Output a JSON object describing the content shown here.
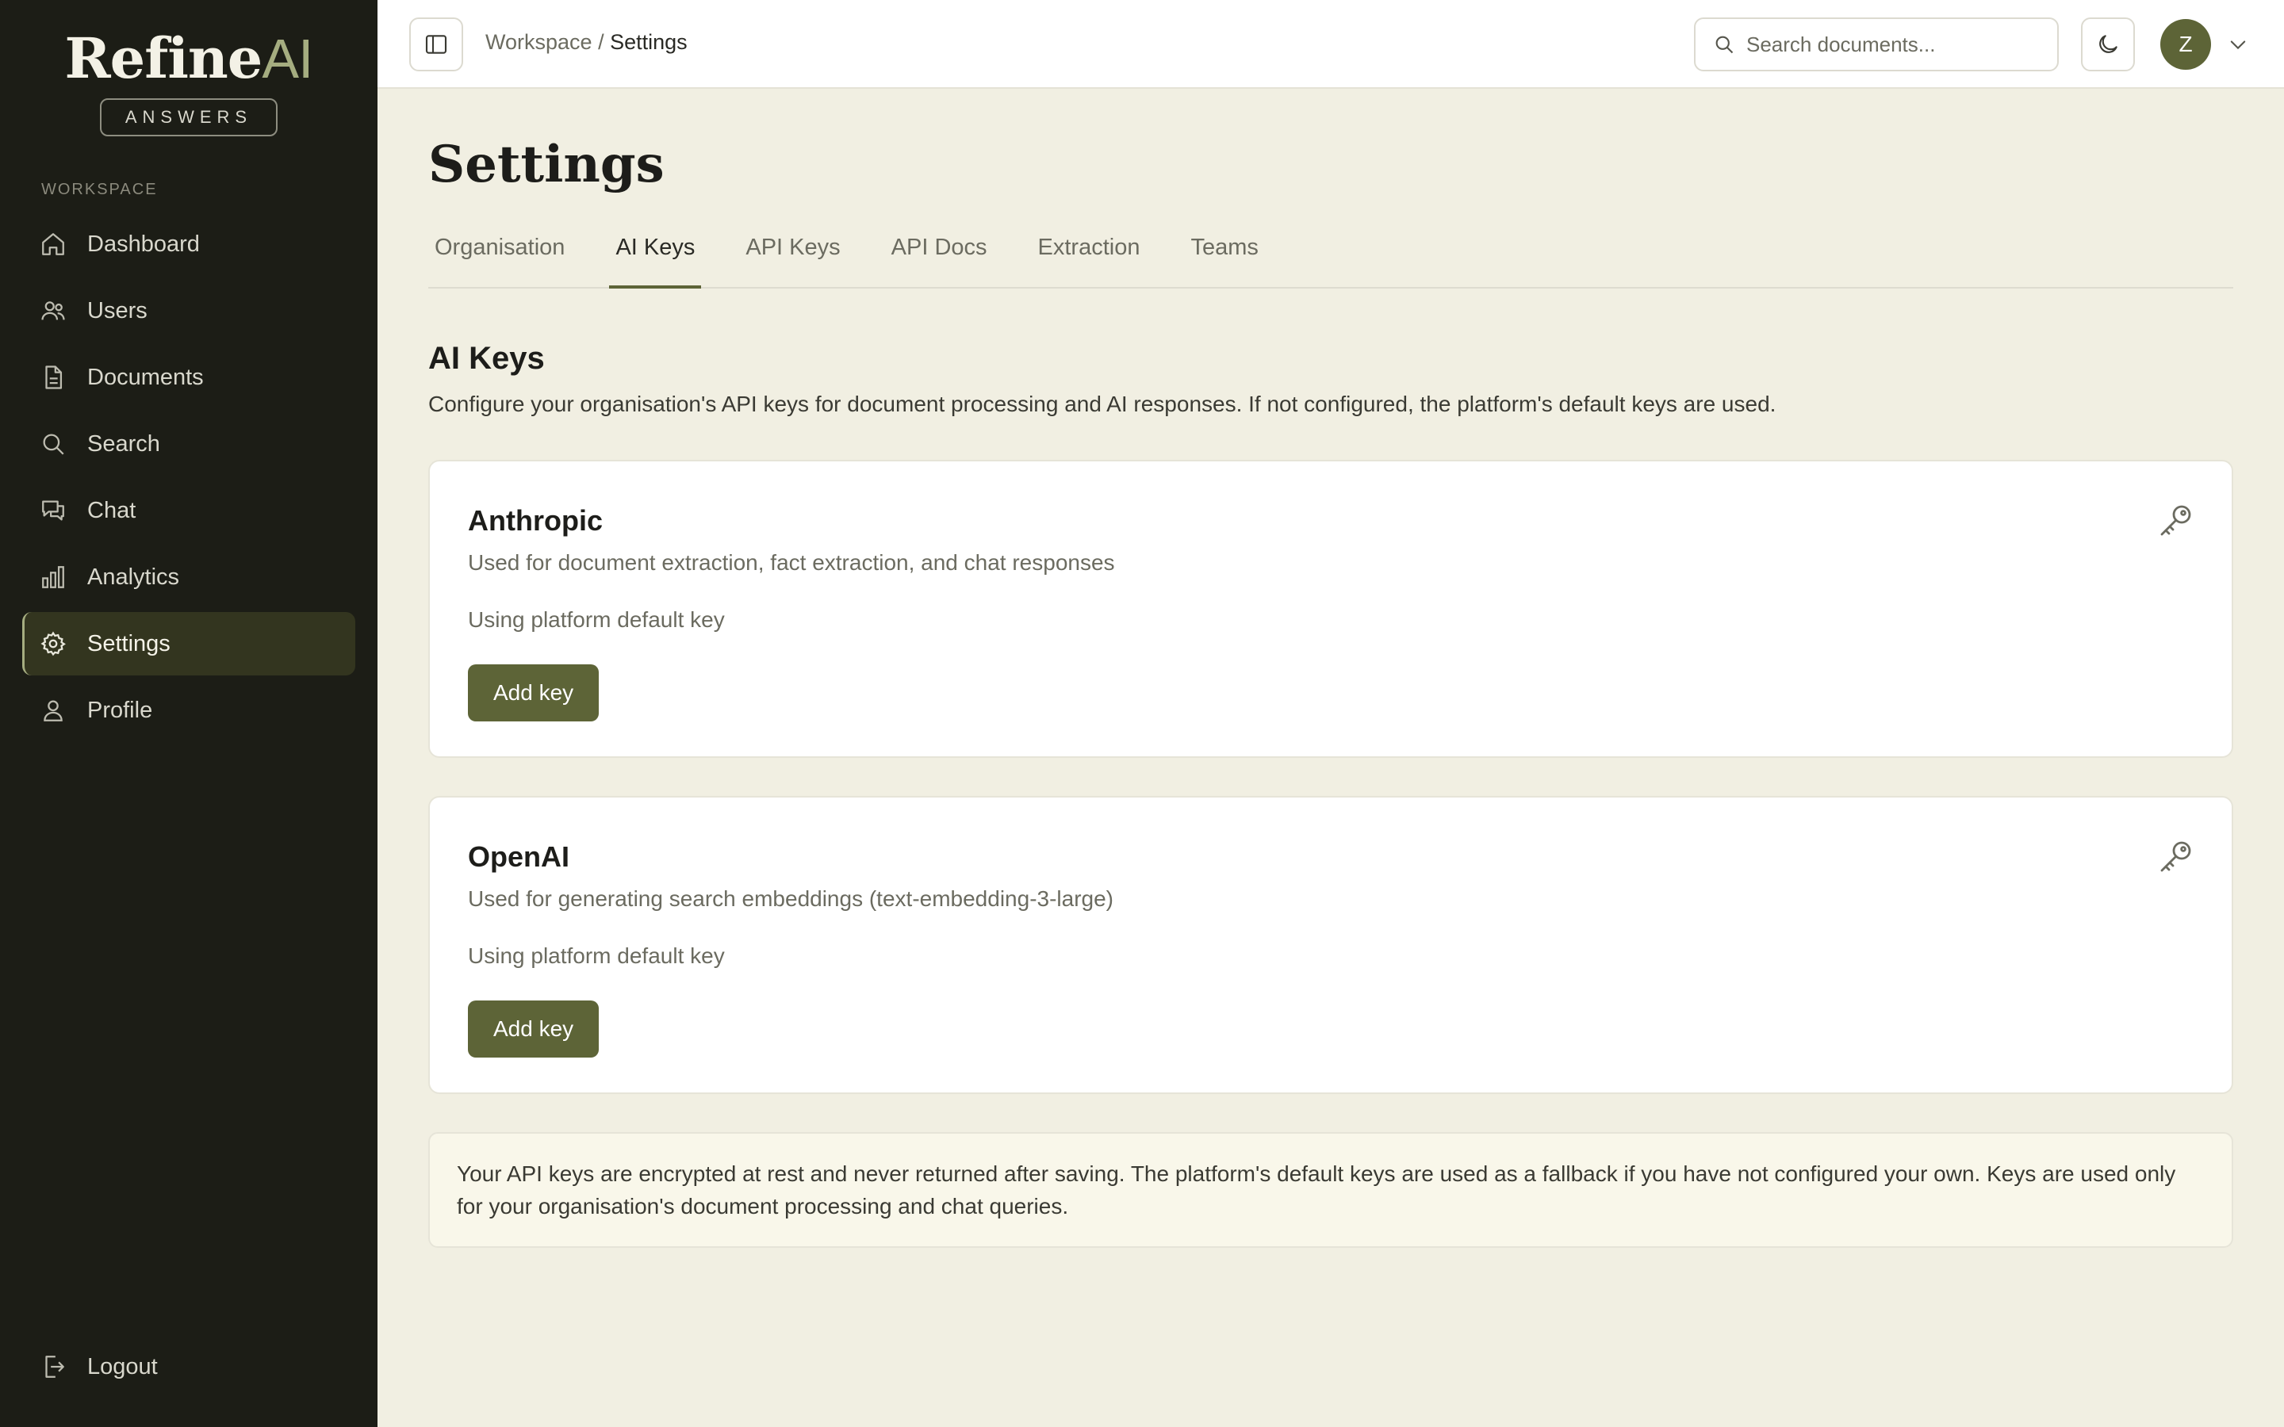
{
  "brand": {
    "name_main": "Refine",
    "name_accent": "AI",
    "subtitle": "ANSWERS"
  },
  "sidebar": {
    "section_label": "WORKSPACE",
    "items": [
      {
        "label": "Dashboard",
        "icon": "home-icon"
      },
      {
        "label": "Users",
        "icon": "users-icon"
      },
      {
        "label": "Documents",
        "icon": "document-icon"
      },
      {
        "label": "Search",
        "icon": "search-icon"
      },
      {
        "label": "Chat",
        "icon": "chat-icon"
      },
      {
        "label": "Analytics",
        "icon": "bar-chart-icon"
      },
      {
        "label": "Settings",
        "icon": "gear-icon",
        "active": true
      },
      {
        "label": "Profile",
        "icon": "user-icon"
      }
    ],
    "logout_label": "Logout"
  },
  "topbar": {
    "breadcrumb_parent": "Workspace",
    "breadcrumb_separator": " / ",
    "breadcrumb_current": "Settings",
    "search_placeholder": "Search documents...",
    "avatar_initial": "Z"
  },
  "main": {
    "title": "Settings",
    "tabs": [
      {
        "label": "Organisation"
      },
      {
        "label": "AI Keys",
        "active": true
      },
      {
        "label": "API Keys"
      },
      {
        "label": "API Docs"
      },
      {
        "label": "Extraction"
      },
      {
        "label": "Teams"
      }
    ],
    "section_title": "AI Keys",
    "section_desc": "Configure your organisation's API keys for document processing and AI responses. If not configured, the platform's default keys are used.",
    "cards": [
      {
        "title": "Anthropic",
        "desc": "Used for document extraction, fact extraction, and chat responses",
        "status": "Using platform default key",
        "button": "Add key"
      },
      {
        "title": "OpenAI",
        "desc": "Used for generating search embeddings (text-embedding-3-large)",
        "status": "Using platform default key",
        "button": "Add key"
      }
    ],
    "info": "Your API keys are encrypted at rest and never returned after saving. The platform's default keys are used as a fallback if you have not configured your own. Keys are used only for your organisation's document processing and chat queries."
  },
  "colors": {
    "sidebar_bg": "#1c1d16",
    "accent": "#5d6437",
    "accent_light": "#a5ad80",
    "page_bg": "#f1efe2"
  }
}
